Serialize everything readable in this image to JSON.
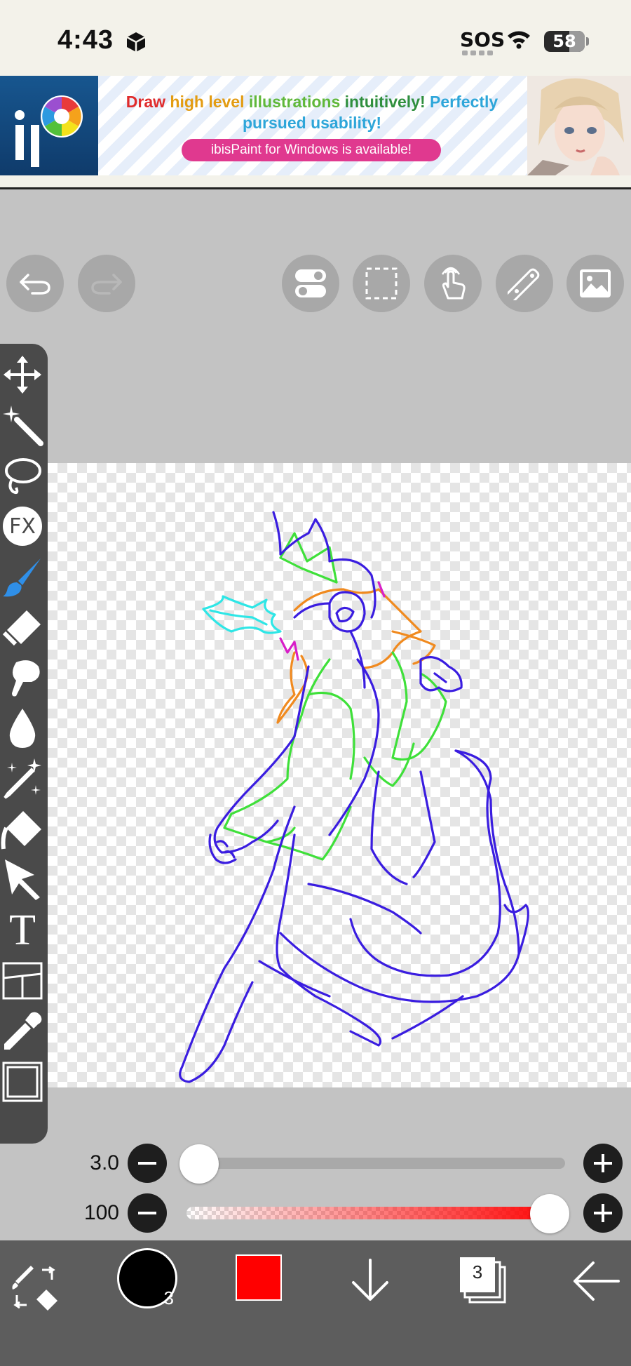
{
  "status": {
    "time": "4:43",
    "sos": "SOS",
    "battery": "58"
  },
  "ad": {
    "headline_parts": [
      "Draw",
      "high level",
      "illustrations",
      "intuitively!",
      "Perfectly"
    ],
    "headline_line2": "pursued usability!",
    "pill": "ibisPaint for Windows is available!"
  },
  "top_toolbar": {
    "buttons": [
      "undo-icon",
      "redo-icon",
      "toggle-icon",
      "selection-icon",
      "touch-gesture-icon",
      "ruler-icon",
      "reference-image-icon"
    ]
  },
  "left_toolbar": {
    "tools": [
      "move-icon",
      "magic-wand-icon",
      "lasso-icon",
      "fx-icon",
      "brush-icon",
      "eraser-icon",
      "smudge-icon",
      "blur-icon",
      "special-pen-icon",
      "fill-icon",
      "select-arrow-icon",
      "text-icon",
      "frame-divider-icon",
      "eyedropper-icon",
      "canvas-icon"
    ],
    "fx_label": "FX",
    "text_label": "T",
    "active_tool": "brush-icon"
  },
  "sliders": {
    "size": {
      "label": "3.0",
      "fraction": 0.0
    },
    "opacity": {
      "label": "100",
      "fraction": 1.0
    }
  },
  "bottom_bar": {
    "brush_badge": "3",
    "layers_count": "3",
    "color": "#ff0000"
  },
  "colors": {
    "accent_blue": "#2f8fe8",
    "stroke_purple": "#3a1de0",
    "stroke_green": "#3fe03a",
    "stroke_orange": "#f08a1f",
    "stroke_cyan": "#2ee6e6",
    "stroke_magenta": "#d81ec8"
  }
}
